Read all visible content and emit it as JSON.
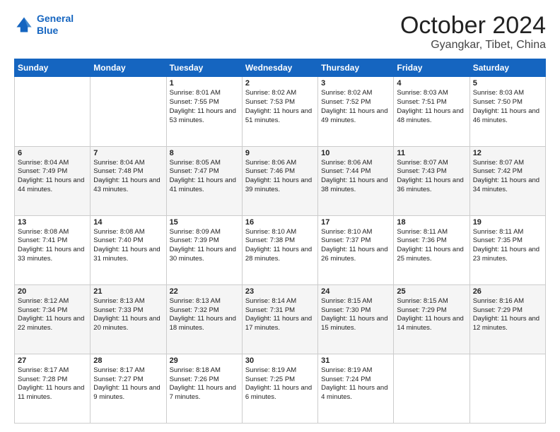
{
  "header": {
    "logo_line1": "General",
    "logo_line2": "Blue",
    "month": "October 2024",
    "location": "Gyangkar, Tibet, China"
  },
  "weekdays": [
    "Sunday",
    "Monday",
    "Tuesday",
    "Wednesday",
    "Thursday",
    "Friday",
    "Saturday"
  ],
  "weeks": [
    [
      {
        "day": "",
        "sunrise": "",
        "sunset": "",
        "daylight": ""
      },
      {
        "day": "",
        "sunrise": "",
        "sunset": "",
        "daylight": ""
      },
      {
        "day": "1",
        "sunrise": "Sunrise: 8:01 AM",
        "sunset": "Sunset: 7:55 PM",
        "daylight": "Daylight: 11 hours and 53 minutes."
      },
      {
        "day": "2",
        "sunrise": "Sunrise: 8:02 AM",
        "sunset": "Sunset: 7:53 PM",
        "daylight": "Daylight: 11 hours and 51 minutes."
      },
      {
        "day": "3",
        "sunrise": "Sunrise: 8:02 AM",
        "sunset": "Sunset: 7:52 PM",
        "daylight": "Daylight: 11 hours and 49 minutes."
      },
      {
        "day": "4",
        "sunrise": "Sunrise: 8:03 AM",
        "sunset": "Sunset: 7:51 PM",
        "daylight": "Daylight: 11 hours and 48 minutes."
      },
      {
        "day": "5",
        "sunrise": "Sunrise: 8:03 AM",
        "sunset": "Sunset: 7:50 PM",
        "daylight": "Daylight: 11 hours and 46 minutes."
      }
    ],
    [
      {
        "day": "6",
        "sunrise": "Sunrise: 8:04 AM",
        "sunset": "Sunset: 7:49 PM",
        "daylight": "Daylight: 11 hours and 44 minutes."
      },
      {
        "day": "7",
        "sunrise": "Sunrise: 8:04 AM",
        "sunset": "Sunset: 7:48 PM",
        "daylight": "Daylight: 11 hours and 43 minutes."
      },
      {
        "day": "8",
        "sunrise": "Sunrise: 8:05 AM",
        "sunset": "Sunset: 7:47 PM",
        "daylight": "Daylight: 11 hours and 41 minutes."
      },
      {
        "day": "9",
        "sunrise": "Sunrise: 8:06 AM",
        "sunset": "Sunset: 7:46 PM",
        "daylight": "Daylight: 11 hours and 39 minutes."
      },
      {
        "day": "10",
        "sunrise": "Sunrise: 8:06 AM",
        "sunset": "Sunset: 7:44 PM",
        "daylight": "Daylight: 11 hours and 38 minutes."
      },
      {
        "day": "11",
        "sunrise": "Sunrise: 8:07 AM",
        "sunset": "Sunset: 7:43 PM",
        "daylight": "Daylight: 11 hours and 36 minutes."
      },
      {
        "day": "12",
        "sunrise": "Sunrise: 8:07 AM",
        "sunset": "Sunset: 7:42 PM",
        "daylight": "Daylight: 11 hours and 34 minutes."
      }
    ],
    [
      {
        "day": "13",
        "sunrise": "Sunrise: 8:08 AM",
        "sunset": "Sunset: 7:41 PM",
        "daylight": "Daylight: 11 hours and 33 minutes."
      },
      {
        "day": "14",
        "sunrise": "Sunrise: 8:08 AM",
        "sunset": "Sunset: 7:40 PM",
        "daylight": "Daylight: 11 hours and 31 minutes."
      },
      {
        "day": "15",
        "sunrise": "Sunrise: 8:09 AM",
        "sunset": "Sunset: 7:39 PM",
        "daylight": "Daylight: 11 hours and 30 minutes."
      },
      {
        "day": "16",
        "sunrise": "Sunrise: 8:10 AM",
        "sunset": "Sunset: 7:38 PM",
        "daylight": "Daylight: 11 hours and 28 minutes."
      },
      {
        "day": "17",
        "sunrise": "Sunrise: 8:10 AM",
        "sunset": "Sunset: 7:37 PM",
        "daylight": "Daylight: 11 hours and 26 minutes."
      },
      {
        "day": "18",
        "sunrise": "Sunrise: 8:11 AM",
        "sunset": "Sunset: 7:36 PM",
        "daylight": "Daylight: 11 hours and 25 minutes."
      },
      {
        "day": "19",
        "sunrise": "Sunrise: 8:11 AM",
        "sunset": "Sunset: 7:35 PM",
        "daylight": "Daylight: 11 hours and 23 minutes."
      }
    ],
    [
      {
        "day": "20",
        "sunrise": "Sunrise: 8:12 AM",
        "sunset": "Sunset: 7:34 PM",
        "daylight": "Daylight: 11 hours and 22 minutes."
      },
      {
        "day": "21",
        "sunrise": "Sunrise: 8:13 AM",
        "sunset": "Sunset: 7:33 PM",
        "daylight": "Daylight: 11 hours and 20 minutes."
      },
      {
        "day": "22",
        "sunrise": "Sunrise: 8:13 AM",
        "sunset": "Sunset: 7:32 PM",
        "daylight": "Daylight: 11 hours and 18 minutes."
      },
      {
        "day": "23",
        "sunrise": "Sunrise: 8:14 AM",
        "sunset": "Sunset: 7:31 PM",
        "daylight": "Daylight: 11 hours and 17 minutes."
      },
      {
        "day": "24",
        "sunrise": "Sunrise: 8:15 AM",
        "sunset": "Sunset: 7:30 PM",
        "daylight": "Daylight: 11 hours and 15 minutes."
      },
      {
        "day": "25",
        "sunrise": "Sunrise: 8:15 AM",
        "sunset": "Sunset: 7:29 PM",
        "daylight": "Daylight: 11 hours and 14 minutes."
      },
      {
        "day": "26",
        "sunrise": "Sunrise: 8:16 AM",
        "sunset": "Sunset: 7:29 PM",
        "daylight": "Daylight: 11 hours and 12 minutes."
      }
    ],
    [
      {
        "day": "27",
        "sunrise": "Sunrise: 8:17 AM",
        "sunset": "Sunset: 7:28 PM",
        "daylight": "Daylight: 11 hours and 11 minutes."
      },
      {
        "day": "28",
        "sunrise": "Sunrise: 8:17 AM",
        "sunset": "Sunset: 7:27 PM",
        "daylight": "Daylight: 11 hours and 9 minutes."
      },
      {
        "day": "29",
        "sunrise": "Sunrise: 8:18 AM",
        "sunset": "Sunset: 7:26 PM",
        "daylight": "Daylight: 11 hours and 7 minutes."
      },
      {
        "day": "30",
        "sunrise": "Sunrise: 8:19 AM",
        "sunset": "Sunset: 7:25 PM",
        "daylight": "Daylight: 11 hours and 6 minutes."
      },
      {
        "day": "31",
        "sunrise": "Sunrise: 8:19 AM",
        "sunset": "Sunset: 7:24 PM",
        "daylight": "Daylight: 11 hours and 4 minutes."
      },
      {
        "day": "",
        "sunrise": "",
        "sunset": "",
        "daylight": ""
      },
      {
        "day": "",
        "sunrise": "",
        "sunset": "",
        "daylight": ""
      }
    ]
  ]
}
